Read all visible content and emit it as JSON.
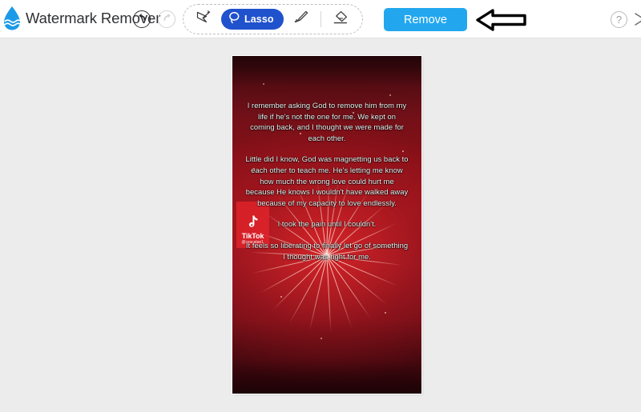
{
  "header": {
    "app_title": "Watermark Remover",
    "logo_icon": "water-drop-icon",
    "undo_icon": "undo-arrow-icon",
    "redo_icon": "redo-arrow-icon",
    "help_icon": "question-mark-icon",
    "help_label": "?",
    "close_icon": "close-x-icon",
    "accent_color": "#22a7ef",
    "tool_active_color": "#1f52cc"
  },
  "toolbar": {
    "tools": [
      {
        "id": "magic-wand",
        "label": "",
        "icon": "magic-wand-icon",
        "active": false
      },
      {
        "id": "lasso",
        "label": "Lasso",
        "icon": "lasso-icon",
        "active": true
      },
      {
        "id": "brush",
        "label": "",
        "icon": "paint-brush-icon",
        "active": false
      },
      {
        "id": "eraser",
        "label": "",
        "icon": "eraser-icon",
        "active": false
      }
    ],
    "remove_label": "Remove"
  },
  "annotation": {
    "arrow_icon": "left-pointing-arrow-icon",
    "arrow_color": "#000000"
  },
  "canvas": {
    "background_color": "#ececed",
    "image": {
      "name": "tiktok-video-frame",
      "watermark": {
        "platform": "TikTok",
        "handle": "@cescatan1",
        "note_icon": "music-note-icon",
        "background_color": "#e4242c"
      },
      "caption_paragraphs": [
        "I remember asking God to remove him from my life if he's not the one for me. We kept on coming back, and I thought we were made for each other.",
        "Little did I know, God was magnetting us back to each other to teach me. He's letting me know how much the wrong love could hurt me because He knows I wouldn't have walked away because of my capacity to love endlessly.",
        "I took the pain until I couldn't.",
        "It feels so liberating to finally let go of something I thought was right for me."
      ]
    }
  }
}
